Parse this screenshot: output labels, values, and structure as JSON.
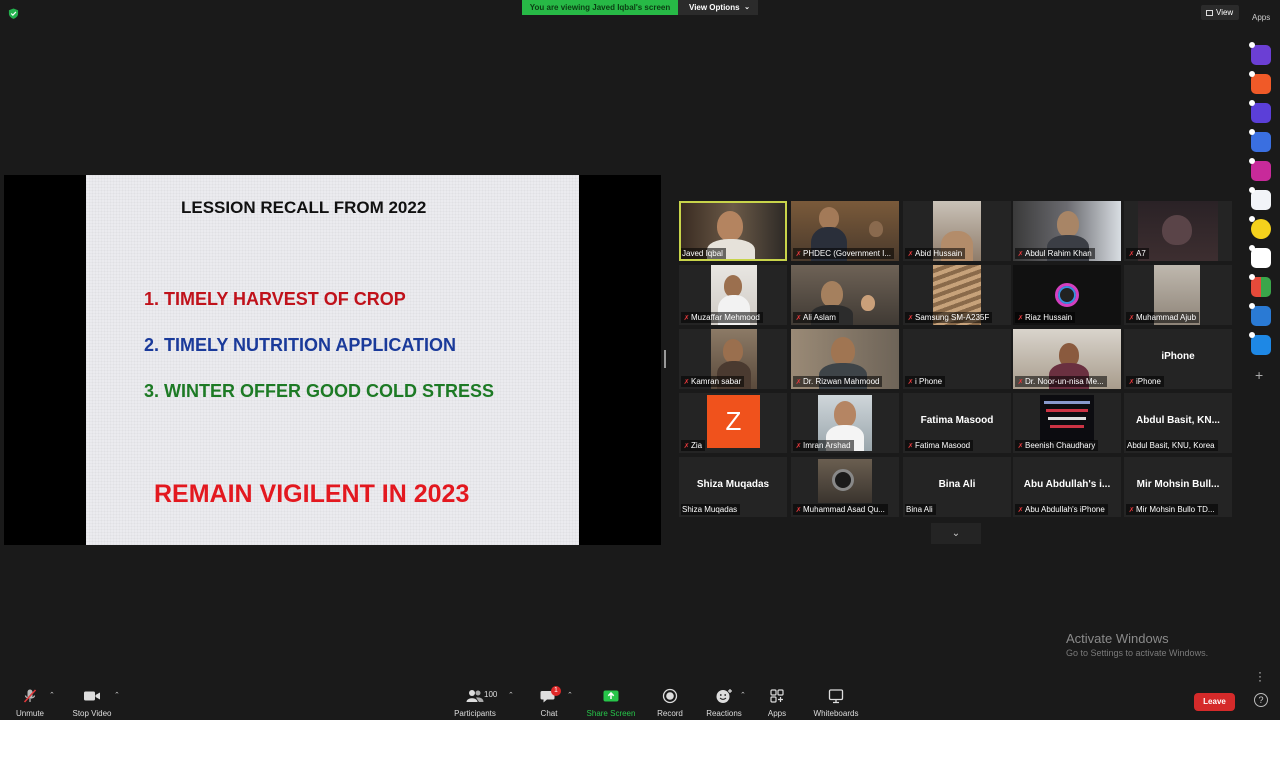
{
  "top_bar": {
    "viewing_banner": "You are viewing Javed Iqbal's screen",
    "view_options_label": "View Options",
    "view_label": "View",
    "apps_label": "Apps"
  },
  "slide": {
    "title": "LESSION RECALL FROM 2022",
    "items": [
      "1. TIMELY HARVEST OF CROP",
      "2. TIMELY NUTRITION APPLICATION",
      "3. WINTER OFFER GOOD COLD STRESS"
    ],
    "footer": "REMAIN VIGILENT IN 2023"
  },
  "gallery": {
    "participants": [
      {
        "name": "Javed Iqbal",
        "muted": false,
        "active": true
      },
      {
        "name": "PHDEC (Government I...",
        "muted": true
      },
      {
        "name": "Abid Hussain",
        "muted": true
      },
      {
        "name": "Abdul Rahim Khan",
        "muted": true
      },
      {
        "name": "A7",
        "muted": true
      },
      {
        "name": "Muzaffar Mehmood",
        "muted": true
      },
      {
        "name": "Ali Aslam",
        "muted": true
      },
      {
        "name": "Samsung SM-A235F",
        "muted": true
      },
      {
        "name": "Riaz Hussain",
        "muted": true
      },
      {
        "name": "Muhammad Ajub",
        "muted": true
      },
      {
        "name": "Kamran sabar",
        "muted": true
      },
      {
        "name": "Dr. Rizwan Mahmood",
        "muted": true
      },
      {
        "name": "i Phone",
        "muted": true
      },
      {
        "name": "Dr. Noor-un-nisa Me...",
        "muted": true
      },
      {
        "name": "iPhone",
        "big_name": "iPhone",
        "muted": true
      },
      {
        "name": "Zia",
        "avatar_letter": "Z",
        "muted": true
      },
      {
        "name": "Imran Arshad",
        "muted": true
      },
      {
        "name": "Fatima Masood",
        "big_name": "Fatima Masood",
        "muted": true
      },
      {
        "name": "Beenish Chaudhary",
        "muted": true
      },
      {
        "name": "Abdul Basit, KNU, Korea",
        "big_name": "Abdul Basit, KN...",
        "muted": false
      },
      {
        "name": "Shiza Muqadas",
        "big_name": "Shiza Muqadas",
        "muted": false
      },
      {
        "name": "Muhammad Asad Qu...",
        "muted": true
      },
      {
        "name": "Bina Ali",
        "big_name": "Bina Ali",
        "muted": false
      },
      {
        "name": "Abu Abdullah's iPhone",
        "big_name": "Abu Abdullah's i...",
        "muted": true
      },
      {
        "name": "Mir Mohsin Bullo TD...",
        "big_name": "Mir Mohsin Bull...",
        "muted": true
      }
    ]
  },
  "watermark": {
    "title": "Activate Windows",
    "subtitle": "Go to Settings to activate Windows."
  },
  "toolbar": {
    "unmute": "Unmute",
    "stop_video": "Stop Video",
    "participants": "Participants",
    "participants_count": "100",
    "chat": "Chat",
    "chat_badge": "1",
    "share_screen": "Share Screen",
    "record": "Record",
    "reactions": "Reactions",
    "apps": "Apps",
    "whiteboards": "Whiteboards",
    "leave": "Leave",
    "help": "?"
  },
  "colors": {
    "background": "#1a1a1a",
    "share_green": "#27b946",
    "leave_red": "#d52a2a",
    "active_speaker": "#c8d44a",
    "slide_red": "#c0121b",
    "slide_blue": "#1a3a9a",
    "slide_green": "#1d7a25"
  },
  "icons": {
    "security": "shield-icon",
    "mic": "microphone-off-icon",
    "video": "video-camera-icon",
    "participants": "people-icon",
    "chat": "chat-bubble-icon",
    "share": "share-arrow-icon",
    "record": "record-icon",
    "reactions": "emoji-plus-icon",
    "apps": "apps-icon",
    "whiteboards": "whiteboard-icon"
  }
}
